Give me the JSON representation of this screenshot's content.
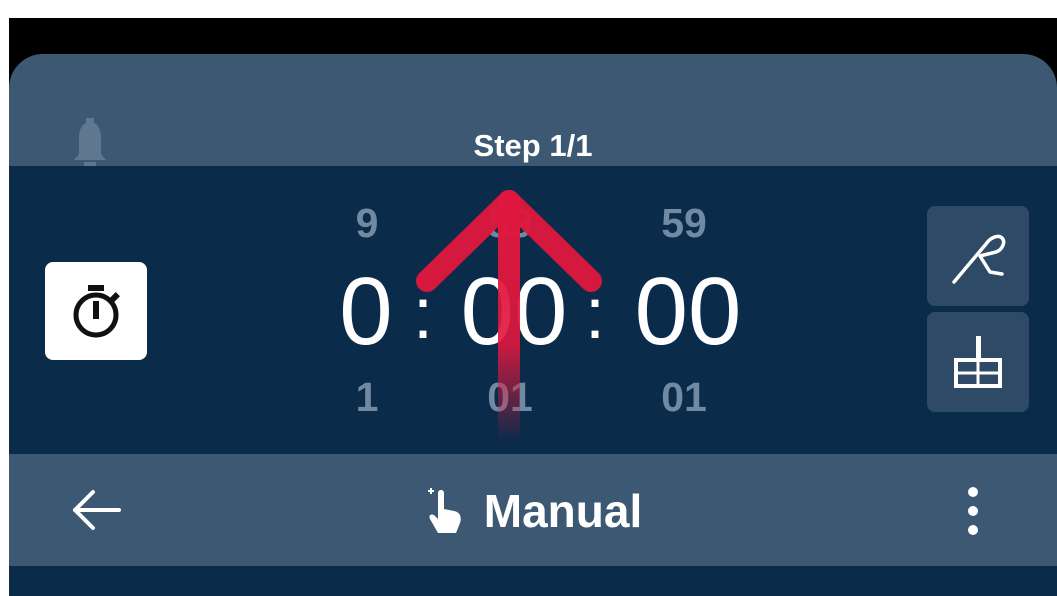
{
  "header": {
    "step_label": "Step 1/1"
  },
  "timer": {
    "hours_above": "9",
    "minutes_above": "59",
    "seconds_above": "59",
    "hours": "0",
    "minutes": "00",
    "seconds": "00",
    "hours_below": "1",
    "minutes_below": "01",
    "seconds_below": "01",
    "separator": ":"
  },
  "footer": {
    "mode_label": "Manual"
  },
  "icons": {
    "bell": "bell-icon",
    "stopwatch": "stopwatch-icon",
    "probe": "probe-icon",
    "tray": "tray-icon",
    "back": "back-arrow-icon",
    "hand": "hand-touch-icon",
    "menu": "more-vert-icon"
  },
  "colors": {
    "header_bg": "#3d5873",
    "timer_bg": "#0b2b4a",
    "dim_digit": "#6f8aa2",
    "overlay_arrow": "#e0173e"
  }
}
